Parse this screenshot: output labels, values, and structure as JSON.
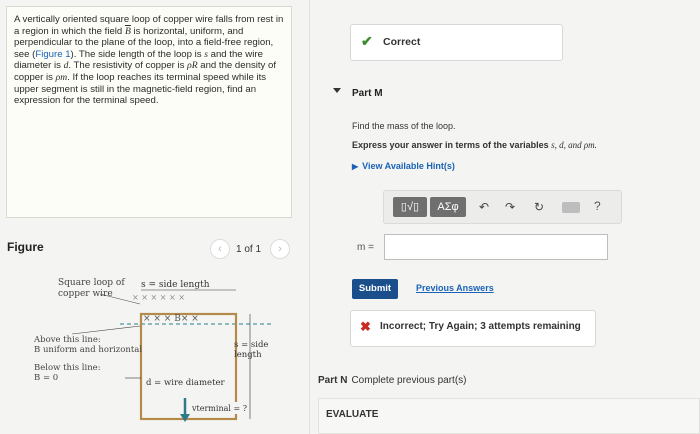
{
  "problem": {
    "t1": "A vertically oriented square loop of copper wire falls from rest in a region in which the field ",
    "field_symbol": "B",
    "t2": " is horizontal, uniform, and perpendicular to the plane of the loop, into a field-free region, see (",
    "figure_link": "Figure 1",
    "t3": "). The side length of the loop is ",
    "side_var": "s",
    "t4": " and the wire diameter is ",
    "diam_var": "d",
    "t5": ". The resistivity of copper is ",
    "rho_r": "ρR",
    "t6": " and the density of copper is ",
    "rho_m": "ρm",
    "t7": ". If the loop reaches its terminal speed while its upper segment is still in the magnetic-field region, find an expression for the terminal speed."
  },
  "figure": {
    "title": "Figure",
    "pager": "1 of 1",
    "prev_icon": "chevron-left-icon",
    "next_icon": "chevron-right-icon",
    "loop_label_1": "Square loop of",
    "loop_label_2": "copper wire",
    "side_length_label": "s = side length",
    "above_1": "Above this line:",
    "above_2": "B uniform and horizontal",
    "below_1": "Below this line:",
    "below_2": "B = 0",
    "side_right_1": "s = side",
    "side_right_2": "length",
    "wire_diameter": "d = wire diameter",
    "vterminal": "vterminal = ?",
    "field_x": "× × × B× ×"
  },
  "status_correct": {
    "icon": "check-icon",
    "text": "Correct"
  },
  "part_m": {
    "label": "Part M",
    "find": "Find the mass of the loop.",
    "express_pre": "Express your answer in terms of the variables ",
    "express_vars": "s, d, and ρm.",
    "hint_label": "View Available Hint(s)"
  },
  "toolbar": {
    "template_btn": "▯√▯",
    "greek_btn": "ΑΣφ",
    "undo_icon": "undo-icon",
    "redo_icon": "redo-icon",
    "reset_icon": "reset-icon",
    "keyboard_icon": "keyboard-icon",
    "help": "?"
  },
  "answer": {
    "label": "m =",
    "value": ""
  },
  "actions": {
    "submit": "Submit",
    "previous_answers": "Previous Answers"
  },
  "status_incorrect": {
    "icon": "x-icon",
    "text": "Incorrect; Try Again; 3 attempts remaining"
  },
  "part_n": {
    "label": "Part N",
    "text": "Complete previous part(s)"
  },
  "evaluate": {
    "label": "EVALUATE"
  },
  "colors": {
    "link": "#1a63b8",
    "submit": "#1b4f8c",
    "correct": "#3d8b2f",
    "incorrect": "#c9291e"
  }
}
